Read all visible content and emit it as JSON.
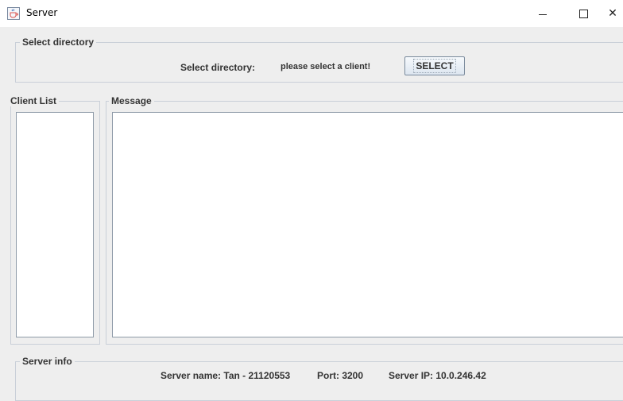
{
  "window": {
    "title": "Server",
    "minimize": "—",
    "maximize": "☐",
    "close": "✕"
  },
  "select_directory": {
    "legend": "Select directory",
    "label": "Select directory:",
    "value": "please select a client!",
    "button_label": "SELECT"
  },
  "client_list": {
    "legend": "Client List",
    "items": []
  },
  "message": {
    "legend": "Message",
    "content": ""
  },
  "server_info": {
    "legend": "Server info",
    "server_name": "Server name: Tan - 21120553",
    "port": "Port: 3200",
    "server_ip": "Server IP: 10.0.246.42"
  },
  "icons": {
    "app": "java-cup-icon"
  }
}
